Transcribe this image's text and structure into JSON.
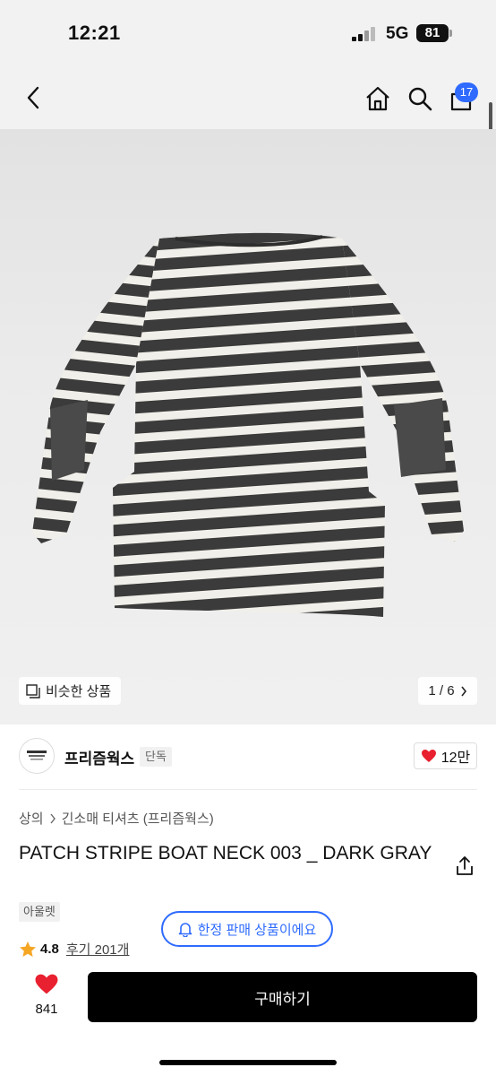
{
  "status_bar": {
    "time": "12:21",
    "network": "5G",
    "battery": "81"
  },
  "nav": {
    "cart_count": "17"
  },
  "gallery": {
    "similar_label": "비슷한 상품",
    "page_indicator": "1 / 6"
  },
  "brand": {
    "name": "프리즘웍스",
    "exclusive_tag": "단독",
    "likes": "12만"
  },
  "product": {
    "breadcrumb": [
      "상의",
      "긴소매 티셔츠 (프리즘웍스)"
    ],
    "title": "PATCH STRIPE BOAT NECK 003 _ DARK GRAY",
    "outlet_tag": "아울렛",
    "rating": "4.8",
    "reviews": "후기 201개"
  },
  "banner": {
    "limited_label": "한정 판매 상품이에요"
  },
  "bottom_bar": {
    "like_count": "841",
    "buy_label": "구매하기"
  },
  "colors": {
    "accent": "#2f6bff",
    "heart": "#e8202f",
    "star": "#f5a623",
    "buy_button": "#000000"
  }
}
